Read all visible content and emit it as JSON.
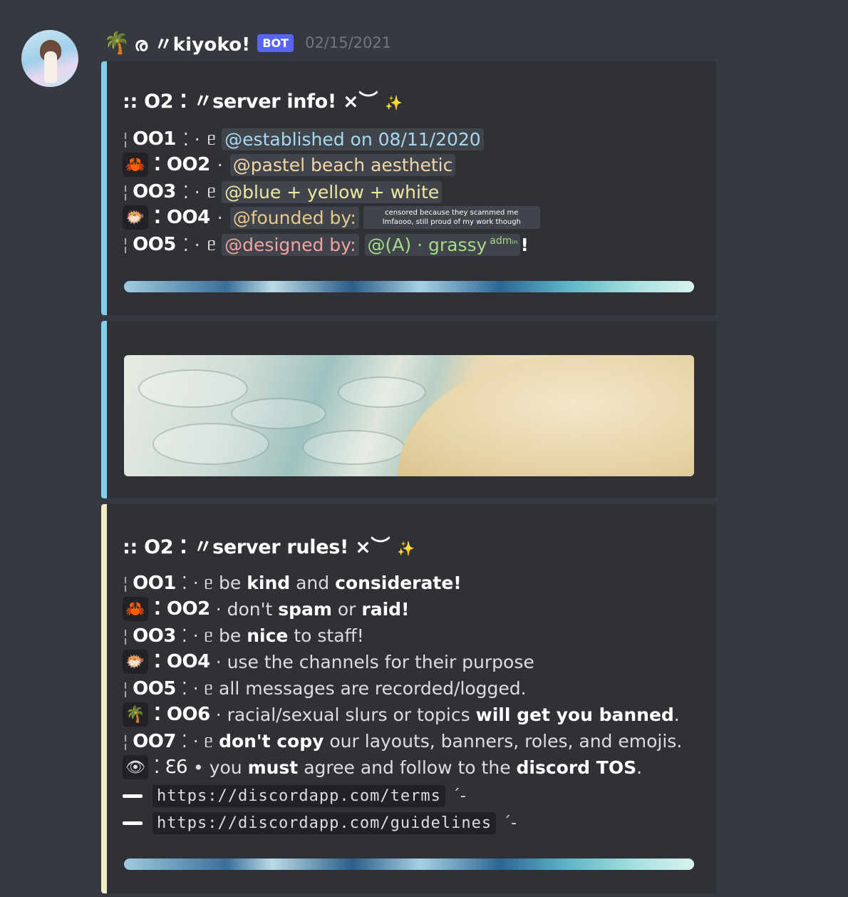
{
  "message": {
    "username": "ര 〃kiyoko!",
    "bot_badge": "BOT",
    "timestamp": "02/15/2021",
    "header_emoji": "🌴"
  },
  "embed1": {
    "accent": "#7fd0e8",
    "title": ":: O2 ⁚ 〃server info! ×︶",
    "title_star": "✨",
    "rows": [
      {
        "num": "OO1",
        "sep": "⁚ ·",
        "swirl": "ᥱ",
        "text": "@established on 08/11/2020",
        "emoji": ""
      },
      {
        "num": "⁚ OO2",
        "sep": "·",
        "swirl": "",
        "text": "@pastel beach aesthetic",
        "emoji": "🦀"
      },
      {
        "num": "OO3",
        "sep": "⁚ ·",
        "swirl": "ᥱ",
        "text": "@blue + yellow + white",
        "emoji": ""
      },
      {
        "num": "⁚ OO4",
        "sep": "·",
        "swirl": "",
        "text": "@founded by:",
        "emoji": "🐡"
      },
      {
        "num": "OO5",
        "sep": "⁚ ·",
        "swirl": "ᥱ",
        "text": "@designed by:",
        "emoji": ""
      }
    ],
    "censor_note": "censored because they scammed me lmfaooo, still proud of my work though",
    "designer": "@(A) · grassy",
    "designer_sup": "admᵢₙ",
    "designer_end": "!"
  },
  "embed2": {
    "accent": "#7fd0e8"
  },
  "embed3": {
    "accent": "#f2ecc6",
    "title": ":: O2 ⁚ 〃server rules! ×︶",
    "title_star": "✨",
    "rules": [
      {
        "num": "OO1",
        "pre": "⁚ · ᥱ be ",
        "b1": "kind",
        "mid": " and ",
        "b2": "considerate!",
        "post": "",
        "emoji": ""
      },
      {
        "num": "⁚ OO2",
        "pre": "· don't ",
        "b1": "spam",
        "mid": " or ",
        "b2": "raid!",
        "post": "",
        "emoji": "🦀"
      },
      {
        "num": "OO3",
        "pre": "⁚ · ᥱ be ",
        "b1": "nice",
        "mid": " to staff!",
        "b2": "",
        "post": "",
        "emoji": ""
      },
      {
        "num": "⁚ OO4",
        "pre": "· use the channels for their purpose",
        "b1": "",
        "mid": "",
        "b2": "",
        "post": "",
        "emoji": "🐡"
      },
      {
        "num": "OO5",
        "pre": "⁚ · ᥱ all messages are recorded/logged.",
        "b1": "",
        "mid": "",
        "b2": "",
        "post": "",
        "emoji": ""
      },
      {
        "num": "⁚ OO6",
        "pre": "· racial/sexual slurs or topics ",
        "b1": "will get you banned",
        "mid": ".",
        "b2": "",
        "post": "",
        "emoji": "🌴"
      },
      {
        "num": "OO7",
        "pre": "⁚ · ᥱ ",
        "b1": "don't copy",
        "mid": " our layouts, banners, roles, and emojis.",
        "b2": "",
        "post": "",
        "emoji": ""
      },
      {
        "num": "⁚ ℇ6",
        "pre": "• you ",
        "b1": "must",
        "mid": " agree and follow to the ",
        "b2": "discord TOS",
        "post": ".",
        "emoji": "👁"
      }
    ],
    "links": [
      {
        "url": "https://discordapp.com/terms",
        "tick": "ˊ-"
      },
      {
        "url": "https://discordapp.com/guidelines",
        "tick": "ˊ-"
      }
    ]
  }
}
